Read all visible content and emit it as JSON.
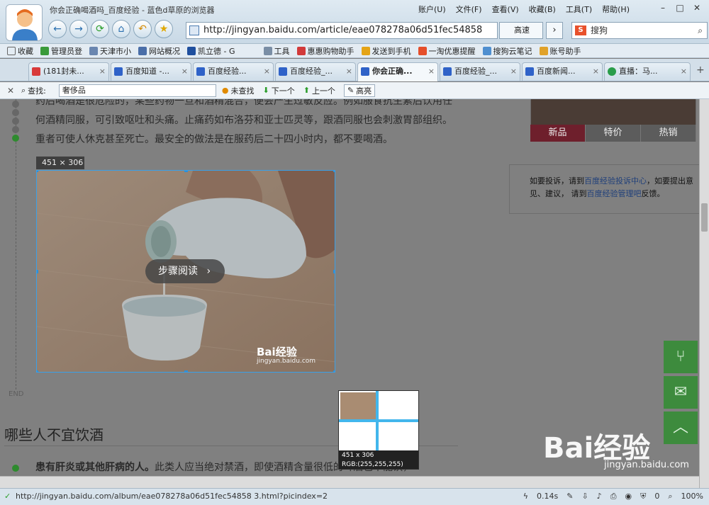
{
  "window": {
    "title": "你会正确喝酒吗_百度经验 - 蓝色d草原的浏览器"
  },
  "menu": [
    "账户(U)",
    "文件(F)",
    "查看(V)",
    "收藏(B)",
    "工具(T)",
    "帮助(H)"
  ],
  "address": {
    "url": "http://jingyan.baidu.com/article/eae078278a06d51fec54858",
    "mode_label": "高速"
  },
  "search": {
    "placeholder": "搜狗",
    "engine_badge": "S"
  },
  "favorites": [
    "收藏",
    "管理员登",
    "天津市小",
    "网站概况",
    "凯立德 - G",
    "工具",
    "惠惠购物助手",
    "发送到手机",
    "一淘优惠提醒",
    "搜狗云笔记",
    "账号助手"
  ],
  "tabs": [
    {
      "label": "(181封未..."
    },
    {
      "label": "百度知道 -..."
    },
    {
      "label": "百度经验..."
    },
    {
      "label": "百度经验_..."
    },
    {
      "label": "你会正确..."
    },
    {
      "label": "百度经验_..."
    },
    {
      "label": "百度新闻..."
    },
    {
      "label": "直播：马..."
    }
  ],
  "find": {
    "label": "查找:",
    "query": "奢侈品",
    "not_found": "未查找",
    "next": "下一个",
    "prev": "上一个",
    "highlight": "高亮"
  },
  "article": {
    "p1": "药后喝酒是很危险的，某些药物一旦和酒精混合，便会产生过敏反应。例如服食抗生素后饮用任何酒精同服，可引致呕吐和头痛。止痛药如布洛芬和亚士匹灵等，跟酒同服也会刺激胃部组织。重者可使人休克甚至死亡。最安全的做法是在服药后二十四小时内，都不要喝酒。",
    "image_size_tag": "451 × 306",
    "step_read": "步骤阅读",
    "image_watermark_logo": "Bai经验",
    "image_watermark_url": "jingyan.baidu.com",
    "end_label": "END",
    "section_title": "哪些人不宜饮酒",
    "bullet_bold": "患有肝炎或其他肝病的人。",
    "bullet_rest": "此类人应当绝对禁酒，即使酒精含量很低的啤酒也不能饮，"
  },
  "sidebar": {
    "ad_tabs": [
      "新品",
      "特价",
      "热销"
    ],
    "report_prefix": "如要投诉，请到",
    "report_link1": "百度经验投诉中心",
    "report_mid": "，如要提出意见、建议， 请到",
    "report_link2": "百度经验管理吧",
    "report_suffix": "反馈。"
  },
  "magnifier": {
    "size": "451 x 306",
    "rgb": "RGB:(255,255,255)"
  },
  "watermark": {
    "logo": "Bai经验",
    "url": "jingyan.baidu.com"
  },
  "status": {
    "url": "http://jingyan.baidu.com/album/eae078278a06d51fec54858 3.html?picindex=2",
    "time": "0.14s",
    "count": "0",
    "zoom": "100%"
  },
  "colors": {
    "accent_blue": "#3aa0e8",
    "fab_green": "#3d8b3d",
    "ad_selected": "#6e1f2c"
  }
}
